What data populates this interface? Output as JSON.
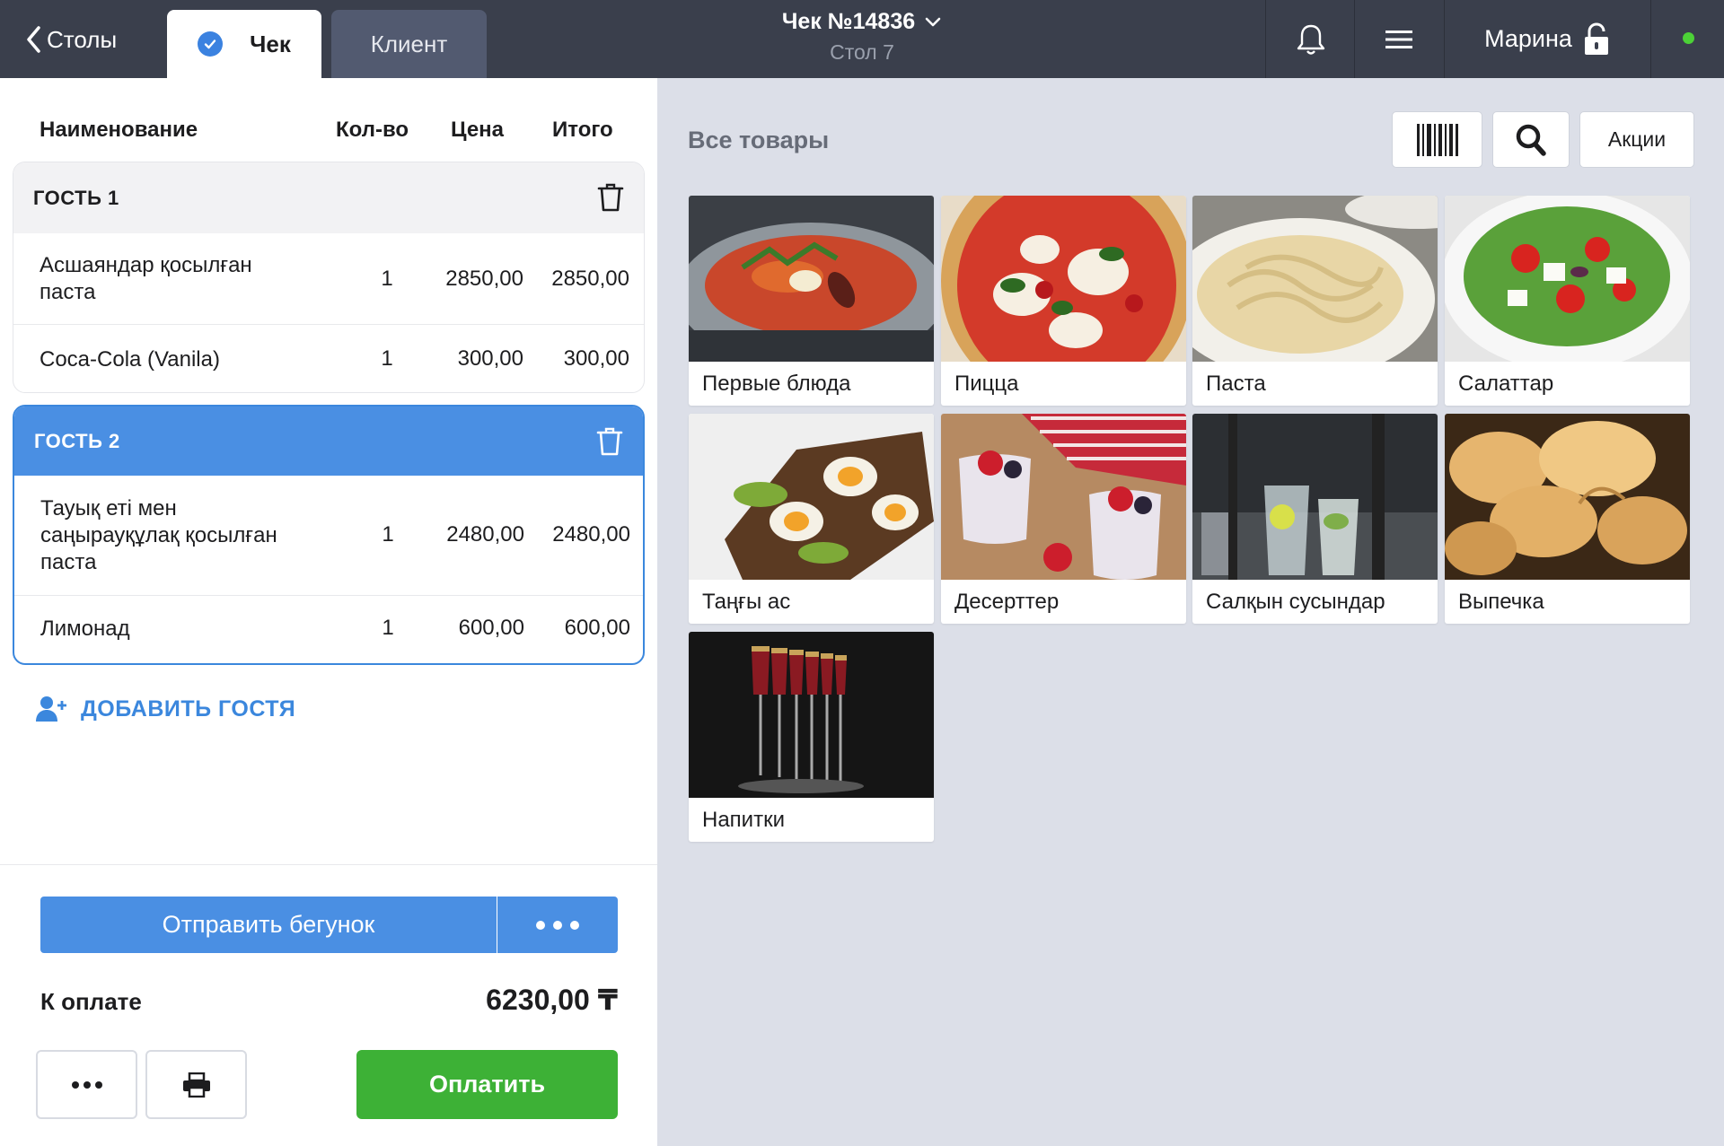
{
  "topbar": {
    "back_label": "Столы",
    "tab_check": "Чек",
    "tab_client": "Клиент",
    "order_title": "Чек №14836",
    "table_label": "Стол 7",
    "user_name": "Марина"
  },
  "order": {
    "columns": {
      "name": "Наименование",
      "qty": "Кол-во",
      "price": "Цена",
      "total": "Итого"
    },
    "guests": [
      {
        "label": "ГОСТЬ 1",
        "selected": false,
        "items": [
          {
            "name_lines": [
              "Асшаяндар қосылған",
              "паста"
            ],
            "qty": "1",
            "price": "2850,00",
            "total": "2850,00"
          },
          {
            "name_lines": [
              "Coca-Cola (Vanila)"
            ],
            "qty": "1",
            "price": "300,00",
            "total": "300,00"
          }
        ]
      },
      {
        "label": "ГОСТЬ 2",
        "selected": true,
        "items": [
          {
            "name_lines": [
              "Тауық еті мен",
              "саңырауқұлақ қосылған",
              "паста"
            ],
            "qty": "1",
            "price": "2480,00",
            "total": "2480,00"
          },
          {
            "name_lines": [
              "Лимонад"
            ],
            "qty": "1",
            "price": "600,00",
            "total": "600,00"
          }
        ]
      }
    ],
    "add_guest_label": "ДОБАВИТЬ ГОСТЯ",
    "send_label": "Отправить бегунок",
    "pay_label": "К оплате",
    "pay_amount": "6230,00 ₸",
    "pay_button": "Оплатить"
  },
  "catalog": {
    "title": "Все товары",
    "promo_label": "Акции",
    "categories": [
      {
        "label": "Первые блюда",
        "icon": "soup-image"
      },
      {
        "label": "Пицца",
        "icon": "pizza-image"
      },
      {
        "label": "Паста",
        "icon": "pasta-image"
      },
      {
        "label": "Салаттар",
        "icon": "salad-image"
      },
      {
        "label": "Таңғы ас",
        "icon": "breakfast-image"
      },
      {
        "label": "Десерттер",
        "icon": "dessert-image"
      },
      {
        "label": "Салқын сусындар",
        "icon": "cold-drink-image"
      },
      {
        "label": "Выпечка",
        "icon": "bakery-image"
      },
      {
        "label": "Напитки",
        "icon": "wine-glasses-image"
      }
    ]
  },
  "colors": {
    "topbar": "#3a3f4c",
    "accent_blue": "#4a8fe3",
    "pay_green": "#3db136",
    "status_online": "#4cd137",
    "catalog_bg": "#dcdfe8"
  }
}
